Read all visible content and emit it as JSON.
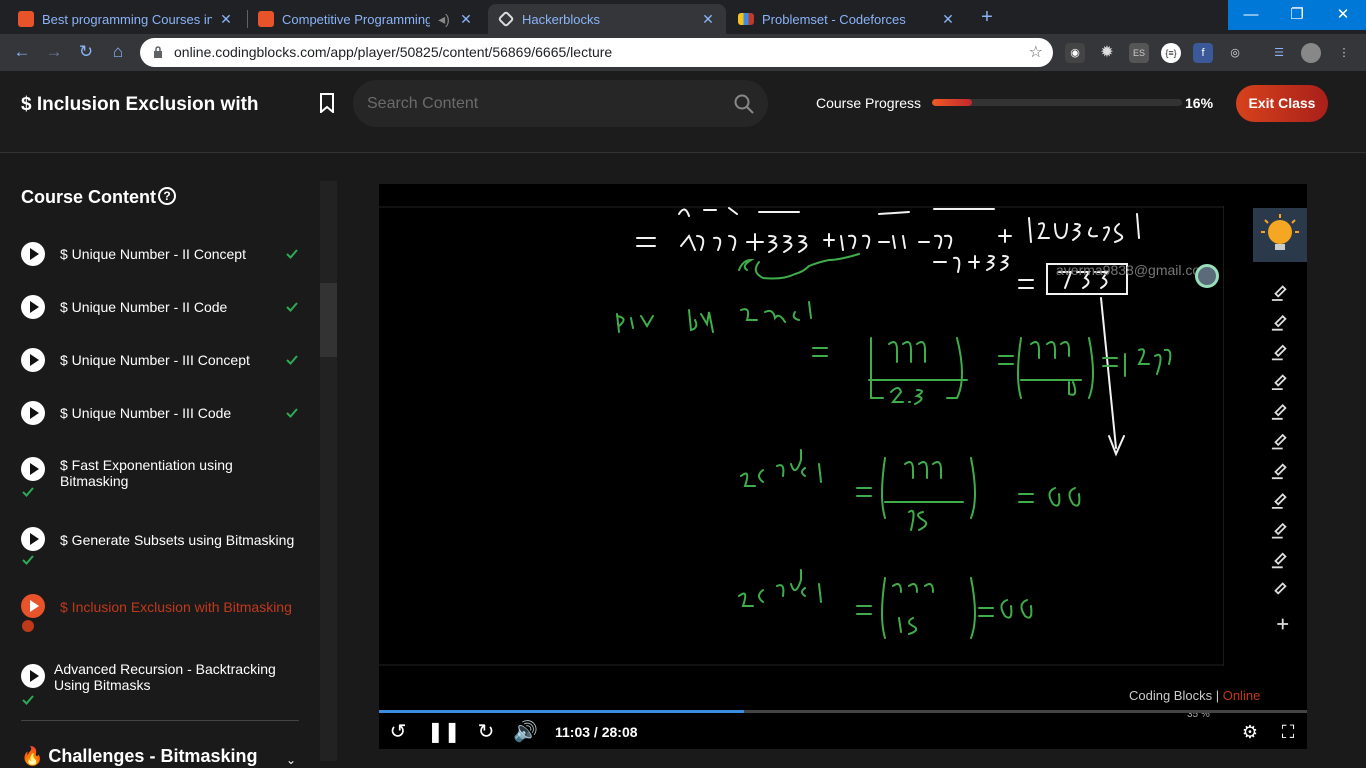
{
  "browser": {
    "tabs": [
      {
        "title": "Best programming Courses in De",
        "favicon_color": "#e8532a",
        "active": false
      },
      {
        "title": "Competitive Programming |",
        "favicon_color": "#e8532a",
        "active": false
      },
      {
        "title": "Hackerblocks",
        "favicon_color": "#ffffff",
        "active": true
      },
      {
        "title": "Problemset - Codeforces",
        "favicon_color": "#3b8de0",
        "active": false
      }
    ],
    "url": "online.codingblocks.com/app/player/50825/content/56869/6665/lecture"
  },
  "header": {
    "course_title": "$ Inclusion Exclusion with",
    "search_placeholder": "Search Content",
    "progress_label": "Course Progress",
    "progress_value": 0.16,
    "progress_text": "16%",
    "exit_label": "Exit Class"
  },
  "sidebar": {
    "title": "Course Content",
    "help_glyph": "?",
    "lessons": [
      {
        "label": "$ Unique Number - II Concept",
        "done": true
      },
      {
        "label": "$ Unique Number - II Code",
        "done": true
      },
      {
        "label": "$ Unique Number - III Concept",
        "done": true
      },
      {
        "label": "$ Unique Number - III Code",
        "done": true
      },
      {
        "label": "$ Fast Exponentiation using Bitmasking",
        "done": true
      },
      {
        "label": "$ Generate Subsets using Bitmasking",
        "done": true
      },
      {
        "label": "$ Inclusion Exclusion with Bitmasking",
        "done": false,
        "active": true
      },
      {
        "label": "Advanced Recursion - Backtracking Using Bitmasks",
        "done": true
      }
    ],
    "section": "🔥 Challenges - Bitmasking"
  },
  "player": {
    "watermark": "averma9838@gmail.com",
    "brand_name": "Coding Blocks",
    "brand_suffix": "Online",
    "time": "11:03 / 28:08",
    "played_fraction": 0.393,
    "zoom": "35 %"
  },
  "colors": {
    "accent": "#e8532a",
    "check": "#2eaa55"
  }
}
